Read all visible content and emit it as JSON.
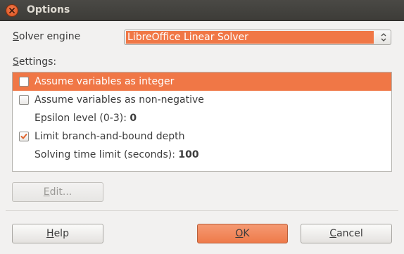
{
  "window": {
    "title": "Options"
  },
  "solver": {
    "label": "Solver engine",
    "label_mnemonic": "S",
    "label_rest": "olver engine",
    "selected_engine": "LibreOffice Linear Solver"
  },
  "settings": {
    "label": "Settings:",
    "label_mnemonic": "S",
    "label_rest": "ettings:",
    "items": [
      {
        "type": "checkbox",
        "label": "Assume variables as integer",
        "checked": false,
        "selected": true
      },
      {
        "type": "checkbox",
        "label": "Assume variables as non-negative",
        "checked": false,
        "selected": false
      },
      {
        "type": "value",
        "label": "Epsilon level (0-3): ",
        "value": "0"
      },
      {
        "type": "checkbox",
        "label": "Limit branch-and-bound depth",
        "checked": true,
        "selected": false
      },
      {
        "type": "value",
        "label": "Solving time limit (seconds): ",
        "value": "100"
      }
    ]
  },
  "buttons": {
    "edit": "Edit...",
    "edit_mnemonic": "E",
    "edit_rest": "dit...",
    "help": "Help",
    "help_mnemonic": "H",
    "help_rest": "elp",
    "ok": "OK",
    "ok_mnemonic": "O",
    "ok_rest": "K",
    "cancel": "Cancel",
    "cancel_mnemonic": "C",
    "cancel_rest": "ancel"
  },
  "colors": {
    "accent": "#f07746",
    "titlebar": "#3d3c38",
    "window_bg": "#f2f1f0"
  },
  "icons": {
    "close": "close-icon",
    "select_arrows": "updown-arrows-icon",
    "check": "checkmark-icon"
  }
}
